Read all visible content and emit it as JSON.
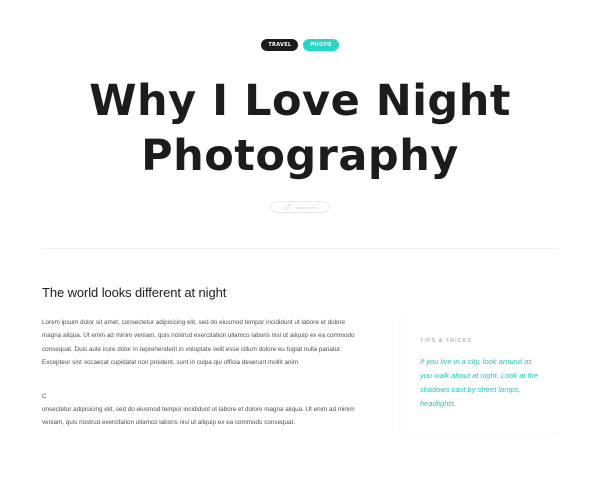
{
  "tags": [
    {
      "label": "TRAVEL",
      "color": "#1b1b1b"
    },
    {
      "label": "PHOTO",
      "color": "#28d6c6"
    }
  ],
  "title_line1": "Why I Love Night",
  "title_line2": "Photography",
  "share": {
    "label": "Share meet",
    "icon": "share-icon"
  },
  "article": {
    "subheading": "The world looks different at night",
    "paragraph1": "Lorem ipsum dolor sit amet, consectetur adipisicing elit, sed do eiusmod tempor incididunt ut labore et dolore magna aliqua. Ut enim ad minim veniam, quis nostrud exercitation ullamco laboris nisi ut aliquip ex ea commodo consequat. Duis aute irure dolor in reprehenderit in voluptate velit esse cillum dolore eu fugiat nulla pariatur. Excepteur sint occaecat cupidatat non proident, sunt in culpa qui officia deserunt mollit anim",
    "paragraph2": "C",
    "paragraph3": "onsectetur adipisicing elit, sed do eiusmod tempor incididunt ut labore et dolore magna aliqua. Ut enim ad minim veniam, quis nostrud exercitation ullamco laboris nisi ut aliquip ex ea commodo consequat."
  },
  "sidebar": {
    "label": "TIPS & TRICKS",
    "quote": "If you live in a city, look around as you walk about at night. Look at the shadows cast by street lamps, headlights."
  },
  "colors": {
    "accent": "#28d6c6",
    "dark": "#1b1b1b",
    "quote": "#22c7b6"
  }
}
